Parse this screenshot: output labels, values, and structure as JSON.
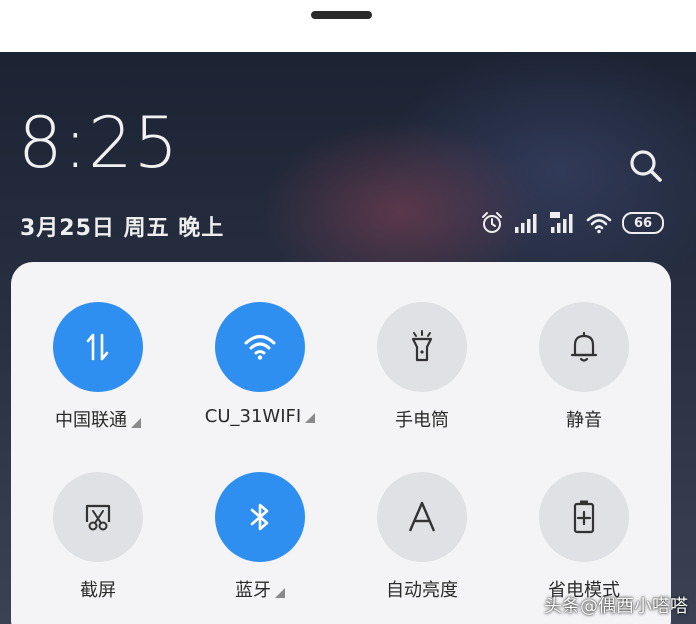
{
  "status": {
    "time": "8:25",
    "date": "3月25日 周五 晚上",
    "battery": "66",
    "icons": [
      "alarm-icon",
      "signal-icon",
      "signal-5g-icon",
      "wifi-icon",
      "battery-icon"
    ]
  },
  "tiles": [
    {
      "label": "中国联通",
      "icon": "mobile-data-icon",
      "active": true,
      "expandable": true
    },
    {
      "label": "CU_31WIFI",
      "icon": "wifi-icon",
      "active": true,
      "expandable": true
    },
    {
      "label": "手电筒",
      "icon": "flashlight-icon",
      "active": false,
      "expandable": false
    },
    {
      "label": "静音",
      "icon": "bell-icon",
      "active": false,
      "expandable": false
    },
    {
      "label": "截屏",
      "icon": "screenshot-icon",
      "active": false,
      "expandable": false
    },
    {
      "label": "蓝牙",
      "icon": "bluetooth-icon",
      "active": true,
      "expandable": true
    },
    {
      "label": "自动亮度",
      "icon": "auto-brightness-icon",
      "active": false,
      "expandable": false
    },
    {
      "label": "省电模式",
      "icon": "battery-saver-icon",
      "active": false,
      "expandable": false
    }
  ],
  "watermark": "头条@偶酉小嗒嗒",
  "colors": {
    "accent": "#2f8ff0",
    "tile_inactive": "#e0e1e4",
    "panel": "#f4f4f6"
  }
}
